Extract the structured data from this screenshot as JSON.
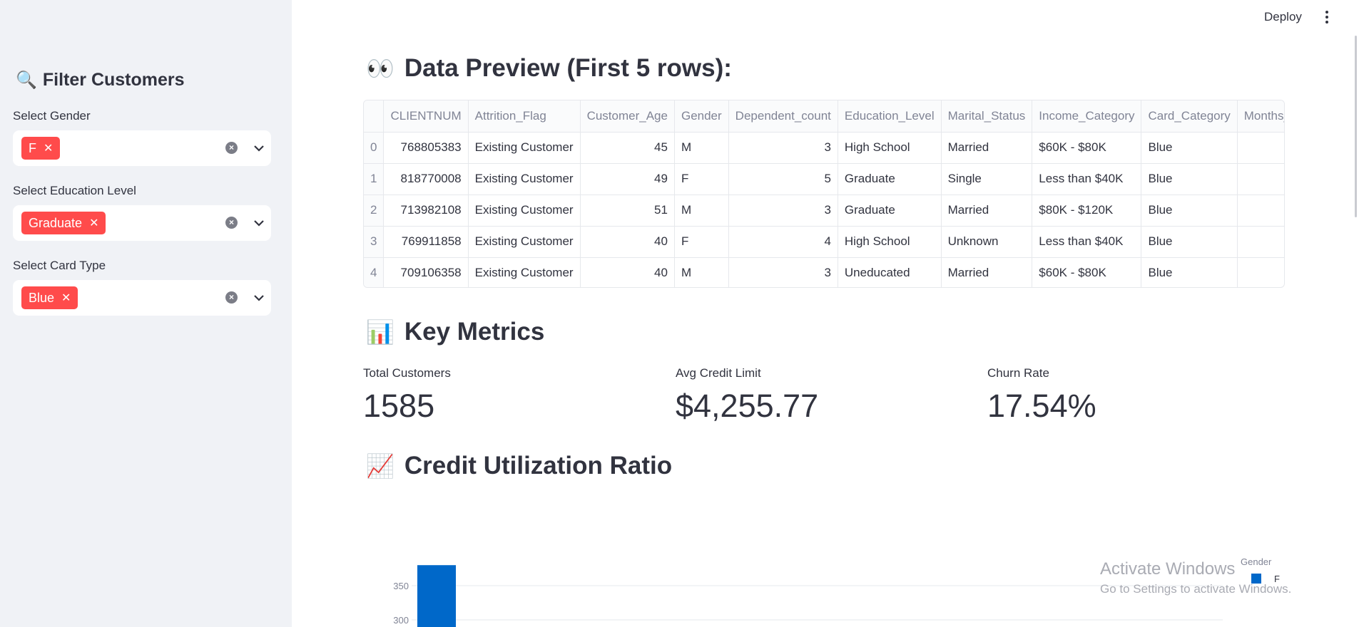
{
  "header": {
    "deploy_label": "Deploy"
  },
  "sidebar": {
    "title": "Filter Customers",
    "title_icon": "🔍",
    "filters": [
      {
        "label": "Select Gender",
        "tags": [
          "F"
        ]
      },
      {
        "label": "Select Education Level",
        "tags": [
          "Graduate"
        ]
      },
      {
        "label": "Select Card Type",
        "tags": [
          "Blue"
        ]
      }
    ]
  },
  "preview": {
    "icon": "👀",
    "title": "Data Preview (First 5 rows):",
    "columns": [
      "",
      "CLIENTNUM",
      "Attrition_Flag",
      "Customer_Age",
      "Gender",
      "Dependent_count",
      "Education_Level",
      "Marital_Status",
      "Income_Category",
      "Card_Category",
      "Months_"
    ],
    "rows": [
      [
        "0",
        "768805383",
        "Existing Customer",
        "45",
        "M",
        "3",
        "High School",
        "Married",
        "$60K - $80K",
        "Blue",
        ""
      ],
      [
        "1",
        "818770008",
        "Existing Customer",
        "49",
        "F",
        "5",
        "Graduate",
        "Single",
        "Less than $40K",
        "Blue",
        ""
      ],
      [
        "2",
        "713982108",
        "Existing Customer",
        "51",
        "M",
        "3",
        "Graduate",
        "Married",
        "$80K - $120K",
        "Blue",
        ""
      ],
      [
        "3",
        "769911858",
        "Existing Customer",
        "40",
        "F",
        "4",
        "High School",
        "Unknown",
        "Less than $40K",
        "Blue",
        ""
      ],
      [
        "4",
        "709106358",
        "Existing Customer",
        "40",
        "M",
        "3",
        "Uneducated",
        "Married",
        "$60K - $80K",
        "Blue",
        ""
      ]
    ]
  },
  "metrics": {
    "icon": "📊",
    "title": "Key Metrics",
    "items": [
      {
        "label": "Total Customers",
        "value": "1585"
      },
      {
        "label": "Avg Credit Limit",
        "value": "$4,255.77"
      },
      {
        "label": "Churn Rate",
        "value": "17.54%"
      }
    ]
  },
  "utilization": {
    "icon": "📈",
    "title": "Credit Utilization Ratio"
  },
  "chart_data": {
    "type": "bar",
    "legend_title": "Gender",
    "series": [
      {
        "name": "F",
        "color": "#0068c9",
        "values": [
          380
        ]
      }
    ],
    "y_ticks": [
      350,
      300
    ],
    "legend_position": "top-right",
    "grid": true
  },
  "watermark": {
    "line1": "Activate Windows",
    "line2": "Go to Settings to activate Windows."
  }
}
